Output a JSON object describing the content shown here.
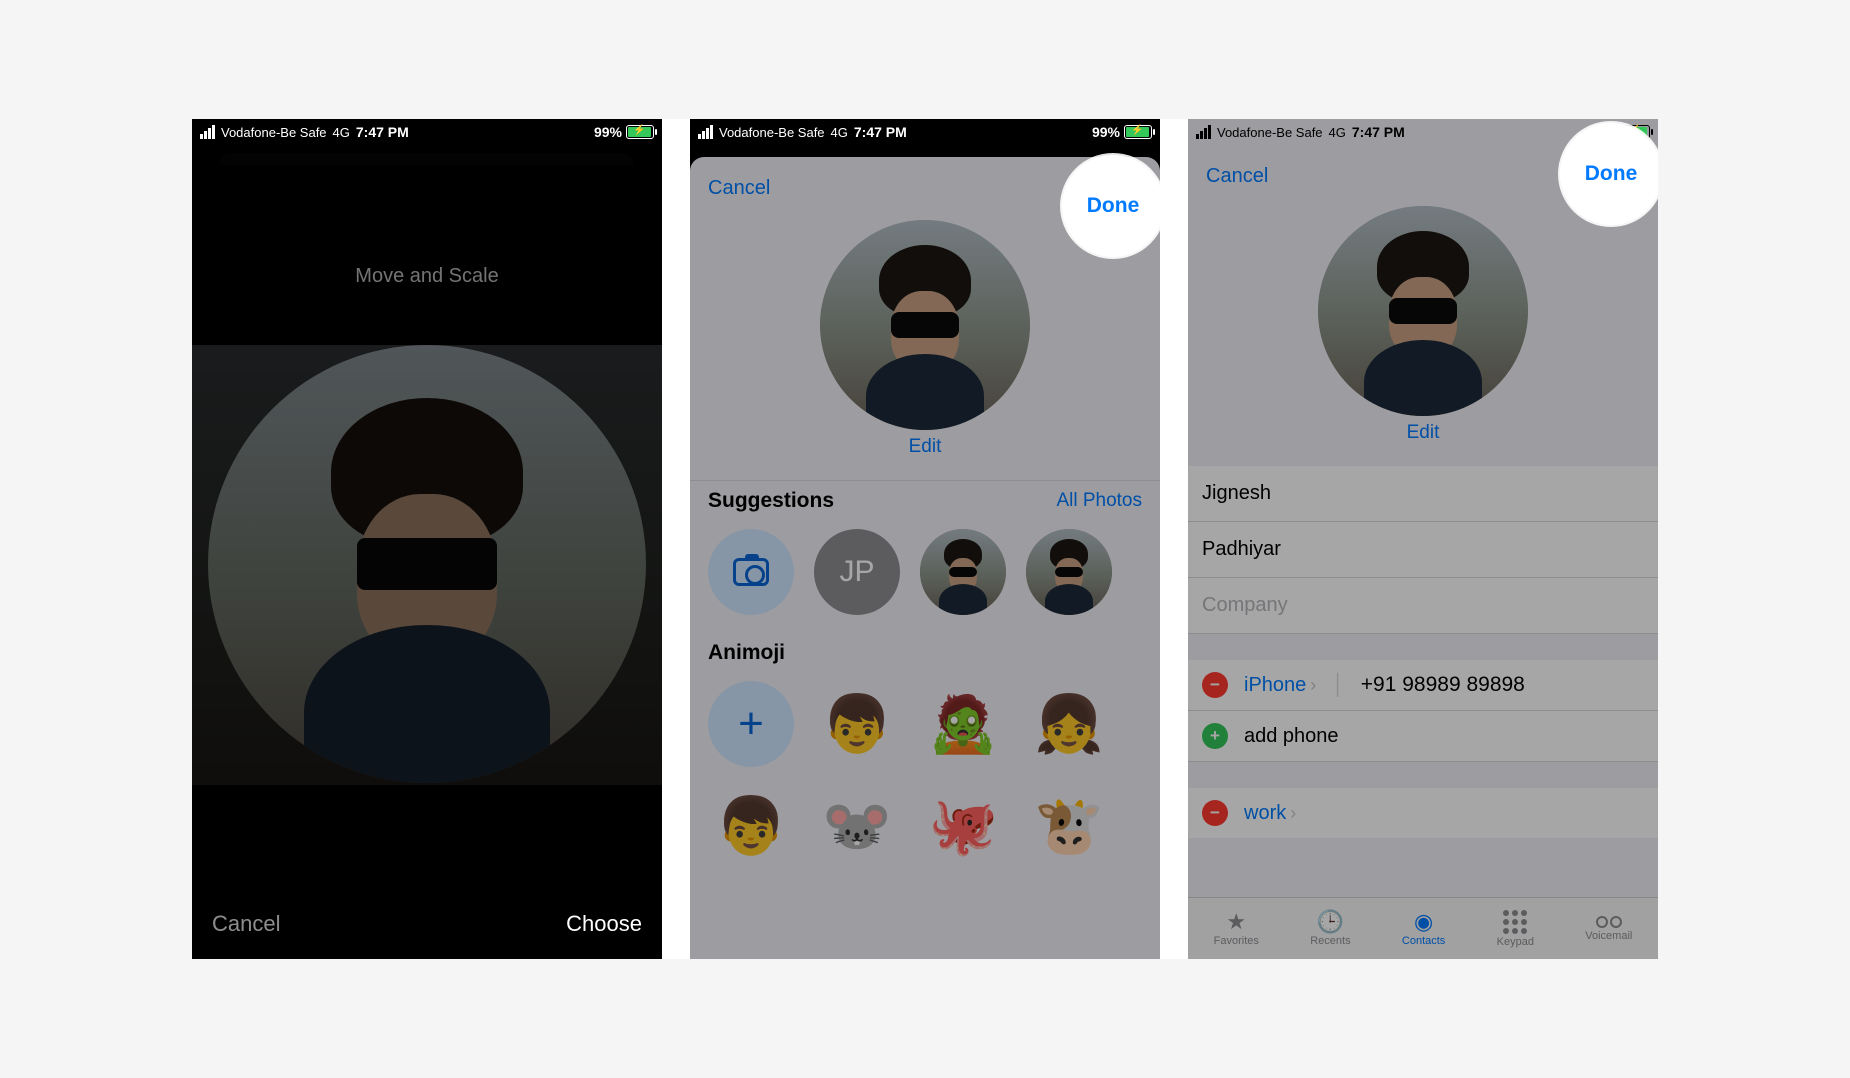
{
  "status": {
    "carrier": "Vodafone-Be Safe",
    "network": "4G",
    "time": "7:47 PM",
    "battery_pct": "99%"
  },
  "screen1": {
    "title": "Move and Scale",
    "cancel": "Cancel",
    "choose": "Choose"
  },
  "screen2": {
    "cancel": "Cancel",
    "done": "Done",
    "edit": "Edit",
    "suggestions": "Suggestions",
    "all_photos": "All Photos",
    "initials": "JP",
    "animoji": "Animoji"
  },
  "screen3": {
    "cancel": "Cancel",
    "done": "Done",
    "edit": "Edit",
    "first_name": "Jignesh",
    "last_name": "Padhiyar",
    "company_placeholder": "Company",
    "phone_label": "iPhone",
    "phone_number": "+91 98989 89898",
    "add_phone": "add phone",
    "work_label": "work",
    "tabs": {
      "favorites": "Favorites",
      "recents": "Recents",
      "contacts": "Contacts",
      "keypad": "Keypad",
      "voicemail": "Voicemail"
    }
  }
}
